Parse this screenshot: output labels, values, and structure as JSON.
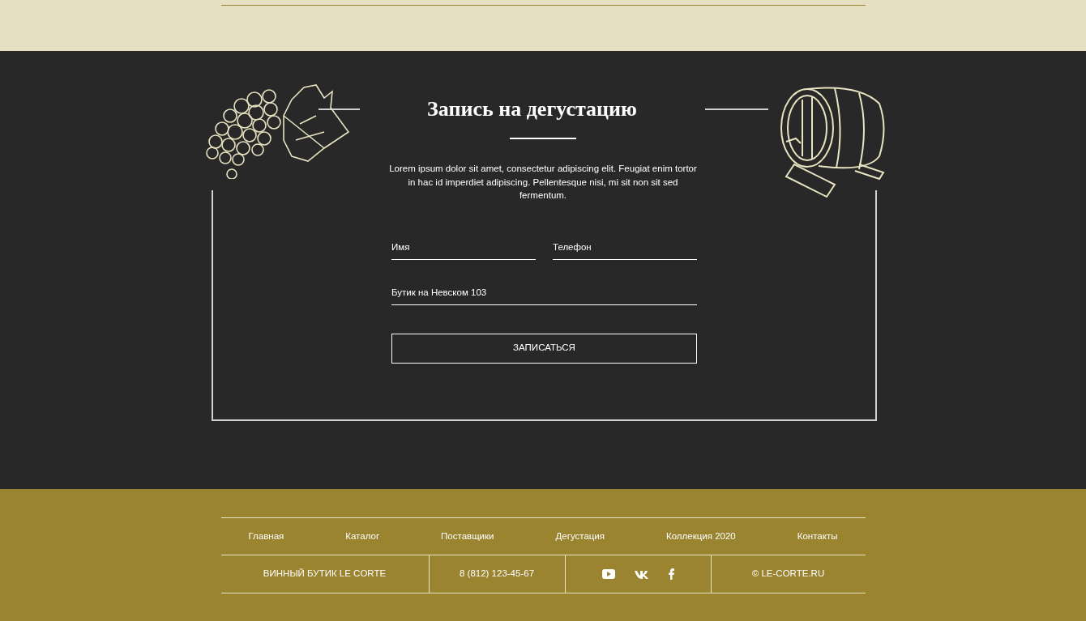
{
  "booking": {
    "title": "Запись на дегустацию",
    "intro": "Lorem ipsum dolor sit amet, consectetur adipiscing elit. Feugiat enim tortor in hac id imperdiet adipiscing. Pellentesque nisi, mi sit non sit sed fermentum.",
    "fields": [
      {
        "placeholder": "Имя"
      },
      {
        "placeholder": "Телефон"
      }
    ],
    "boutique": {
      "value": "Бутик на Невском 103"
    },
    "submit": "ЗАПИСАТЬСЯ"
  },
  "footer": {
    "nav": [
      "Главная",
      "Каталог",
      "Поставщики",
      "Дегустация",
      "Коллекция 2020",
      "Контакты"
    ],
    "brand": "ВИННЫЙ БУТИК LE CORTE",
    "phone": "8 (812) 123-45-67",
    "social": [
      {
        "kind": "youtube"
      },
      {
        "kind": "vk"
      },
      {
        "kind": "facebook"
      }
    ],
    "copyright": "© LE-CORTE.RU"
  }
}
